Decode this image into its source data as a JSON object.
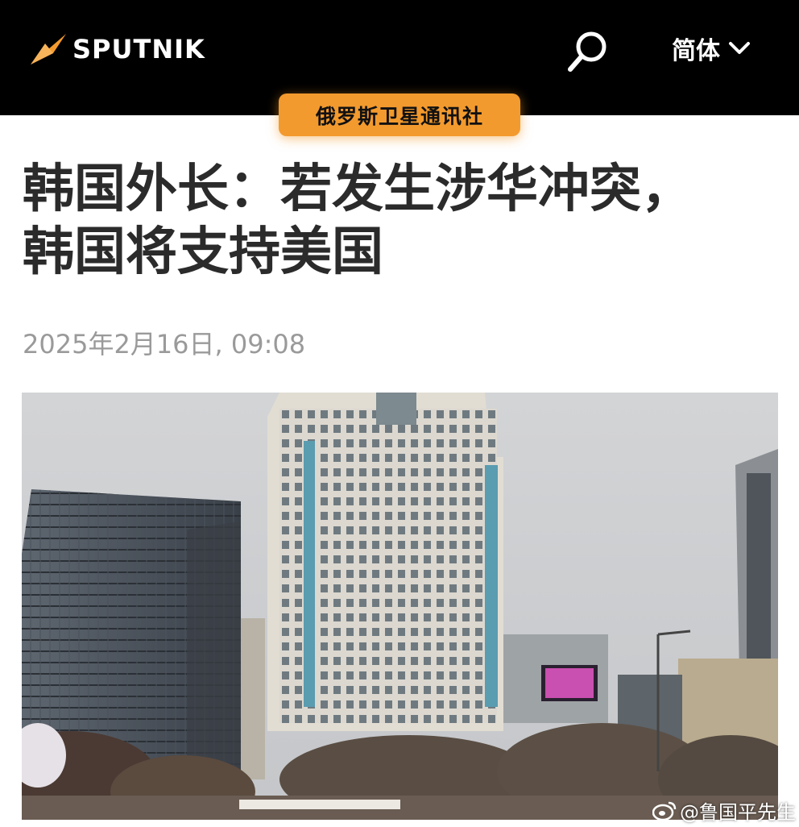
{
  "header": {
    "logo_text": "SPUTNIK",
    "search_icon": "search-icon",
    "language_label": "简体",
    "language_icon": "chevron-down-icon"
  },
  "badge": {
    "label": "俄罗斯卫星通讯社"
  },
  "article": {
    "title_line1": "韩国外长：若发生涉华冲突，",
    "title_line2": "韩国将支持美国",
    "date": "2025年2月16日, 09:08"
  },
  "photo": {
    "description_icon": "city-buildings-photo"
  },
  "watermark": {
    "text": "@鲁国平先生",
    "icon": "weibo-icon"
  },
  "colors": {
    "header_bg": "#000000",
    "accent_orange": "#f39a2e",
    "title_text": "#2b2b2b",
    "date_text": "#9a9a9a"
  }
}
